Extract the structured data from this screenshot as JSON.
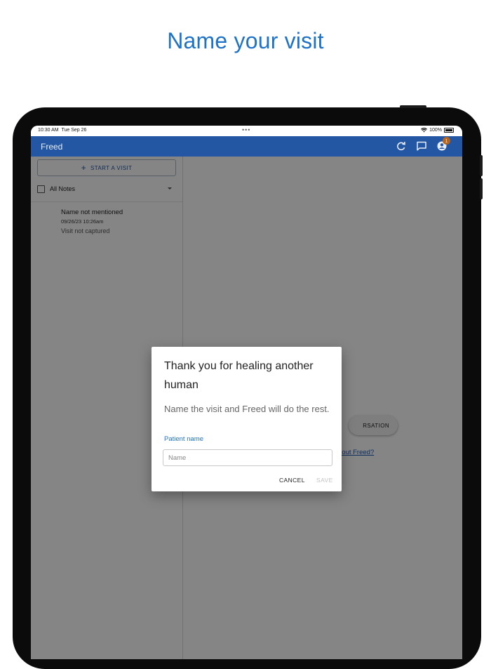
{
  "headline": "Name your visit",
  "status_bar": {
    "time": "10:30 AM",
    "date": "Tue Sep 26",
    "dots": "•••",
    "battery": "100%"
  },
  "app_bar": {
    "title": "Freed",
    "notification_count": "1",
    "icons": [
      "refresh-icon",
      "chat-icon",
      "account-icon"
    ]
  },
  "sidebar": {
    "start_visit_label": "START A VISIT",
    "all_notes_label": "All Notes",
    "notes": [
      {
        "name": "Name not mentioned",
        "datetime": "09/26/23 10:26am",
        "status": "Visit not captured"
      }
    ]
  },
  "main": {
    "conversation_button_partial": "RSATION",
    "about_link_partial": "bout Freed?"
  },
  "dialog": {
    "title": "Thank you for healing another human",
    "body": "Name the visit and Freed will do the rest.",
    "field_label": "Patient name",
    "input_placeholder": "Name",
    "input_value": "",
    "cancel_label": "CANCEL",
    "save_label": "SAVE"
  },
  "colors": {
    "headline": "#1e72c8",
    "app_bar": "#2357a4",
    "notification_badge": "#b5651d",
    "link": "#1e5bb8"
  }
}
